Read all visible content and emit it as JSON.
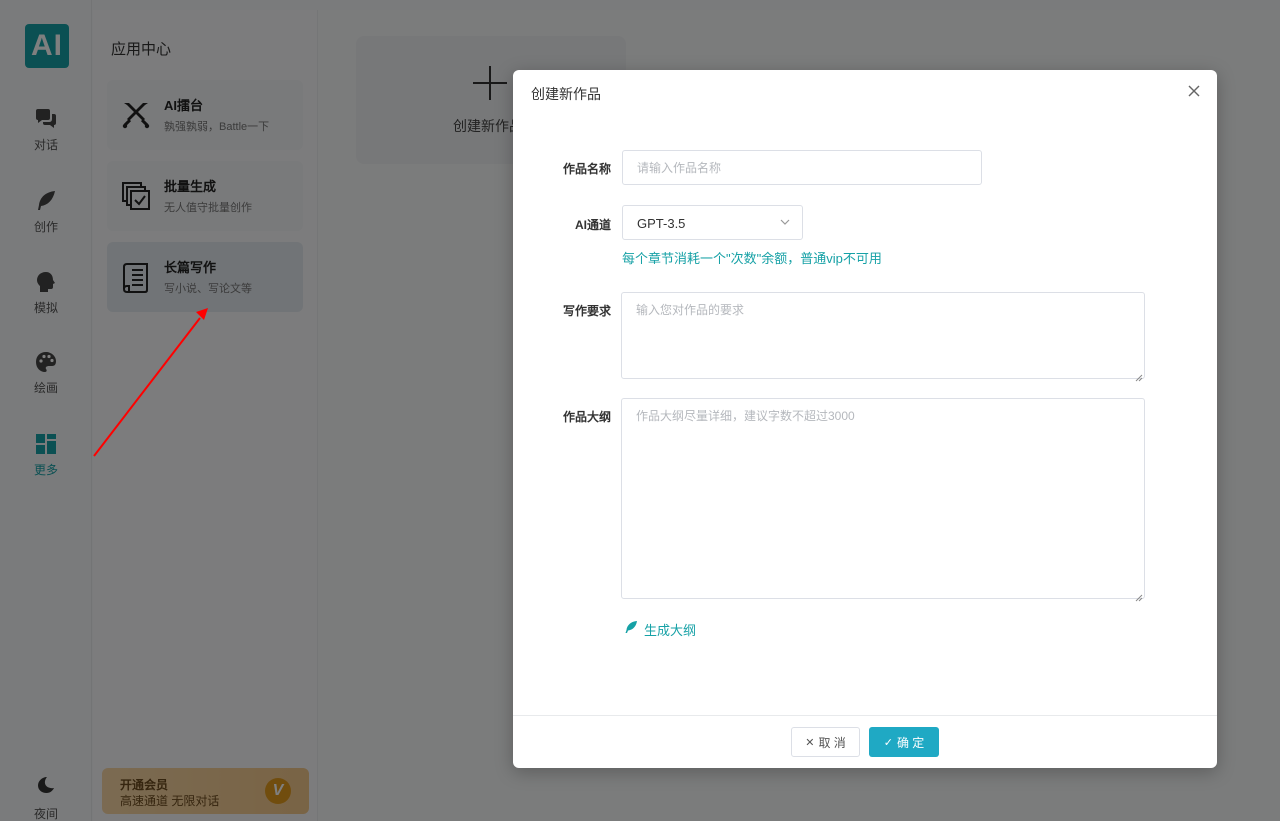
{
  "logo": {
    "text": "AI"
  },
  "nav": [
    {
      "label": "对话",
      "icon": "chat-bubbles-icon"
    },
    {
      "label": "创作",
      "icon": "feather-icon"
    },
    {
      "label": "模拟",
      "icon": "head-profile-icon"
    },
    {
      "label": "绘画",
      "icon": "palette-icon"
    },
    {
      "label": "更多",
      "icon": "grid-icon",
      "active": true
    }
  ],
  "night": {
    "label": "夜间",
    "icon": "moon-icon"
  },
  "apps": {
    "title": "应用中心",
    "items": [
      {
        "title": "AI擂台",
        "subtitle": "孰强孰弱，Battle一下",
        "icon": "crossed-swords-icon"
      },
      {
        "title": "批量生成",
        "subtitle": "无人值守批量创作",
        "icon": "copy-check-icon"
      },
      {
        "title": "长篇写作",
        "subtitle": "写小说、写论文等",
        "icon": "document-icon",
        "active": true
      }
    ],
    "vip": {
      "title": "开通会员",
      "subtitle": "高速通道 无限对话",
      "badge": "V"
    }
  },
  "main": {
    "create_label": "创建新作品"
  },
  "dialog": {
    "title": "创建新作品",
    "fields": {
      "name": {
        "label": "作品名称",
        "value": "",
        "placeholder": "请输入作品名称"
      },
      "channel": {
        "label": "AI通道",
        "value": "GPT-3.5",
        "hint": "每个章节消耗一个\"次数\"余额，普通vip不可用"
      },
      "requirement": {
        "label": "写作要求",
        "value": "",
        "placeholder": "输入您对作品的要求"
      },
      "outline": {
        "label": "作品大纲",
        "value": "",
        "placeholder": "作品大纲尽量详细，建议字数不超过3000"
      }
    },
    "generate_label": "生成大纲",
    "cancel_label": "取 消",
    "confirm_label": "确 定"
  },
  "colors": {
    "accent": "#16a1a6",
    "confirm": "#1fa9c4",
    "annotation_arrow": "#ff0000"
  }
}
